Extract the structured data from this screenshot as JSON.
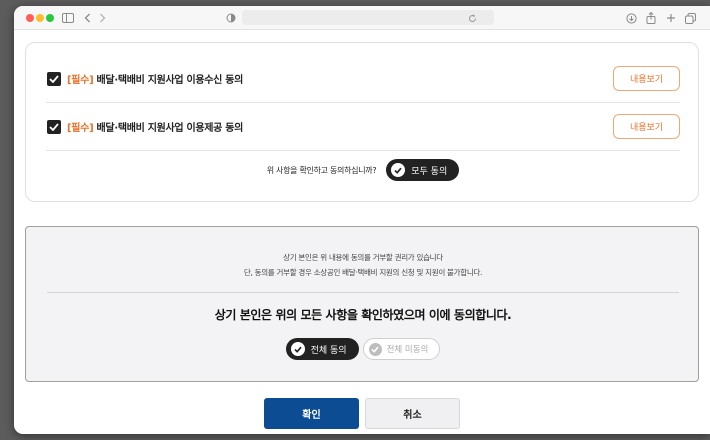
{
  "consent_items": [
    {
      "tag": "[필수]",
      "label": " 배달·택배비 지원사업 이용수신 동의",
      "view_label": "내용보기",
      "checked": true
    },
    {
      "tag": "[필수]",
      "label": " 배달·택배비 지원사업 이용제공 동의",
      "view_label": "내용보기",
      "checked": true
    }
  ],
  "confirm_question": "위 사항을 확인하고 동의하십니까?",
  "agree_all_label": "모두 동의",
  "notice": {
    "line1": "상기 본인은 위 내용에 동의를 거부할 권리가 있습니다",
    "line2": "단, 동의를 거부할 경우 소상공인 배달·택배비 지원의 신청 및 지원이 불가합니다.",
    "title": "상기 본인은 위의 모든 사항을 확인하였으며 이에 동의합니다."
  },
  "choice": {
    "agree_all": "전체 동의",
    "disagree_all": "전체 미동의",
    "selected": "agree_all"
  },
  "buttons": {
    "confirm": "확인",
    "cancel": "취소"
  },
  "colors": {
    "accent_orange": "#e8722a",
    "primary_blue": "#0b4c92",
    "dark_pill": "#222222"
  }
}
